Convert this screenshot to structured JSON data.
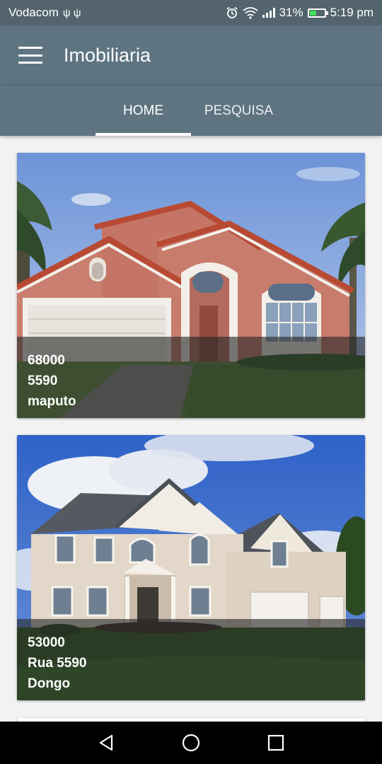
{
  "status_bar": {
    "carrier": "Vodacom",
    "usb_icons": "ψ ψ",
    "battery_percent": "31%",
    "time": "5:19 pm"
  },
  "app_bar": {
    "title": "Imobiliaria"
  },
  "tabs": [
    {
      "label": "HOME",
      "selected": true
    },
    {
      "label": "PESQUISA",
      "selected": false
    }
  ],
  "listings": [
    {
      "price": "68000",
      "line2": "5590",
      "location": "maputo"
    },
    {
      "price": "53000",
      "line2": "Rua 5590",
      "location": "Dongo"
    }
  ],
  "colors": {
    "toolbar": "#5e7581",
    "status_bar": "#53646e",
    "background": "#f2f2f2"
  },
  "icons": [
    "menu-icon",
    "alarm-icon",
    "wifi-icon",
    "signal-icon",
    "battery-icon",
    "back-icon",
    "home-icon",
    "recents-icon"
  ]
}
